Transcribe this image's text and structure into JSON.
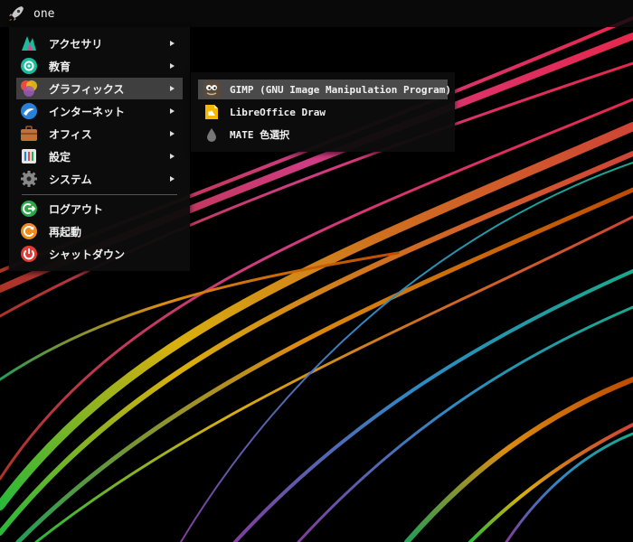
{
  "panel": {
    "launcher_label": "one",
    "launcher_icon": "rocket-icon"
  },
  "main_menu": {
    "items": [
      {
        "label": "アクセサリ",
        "icon": "accessories-icon",
        "submenu": true
      },
      {
        "label": "教育",
        "icon": "education-icon",
        "submenu": true
      },
      {
        "label": "グラフィックス",
        "icon": "graphics-icon",
        "submenu": true,
        "active": true
      },
      {
        "label": "インターネット",
        "icon": "internet-icon",
        "submenu": true
      },
      {
        "label": "オフィス",
        "icon": "office-icon",
        "submenu": true
      },
      {
        "label": "設定",
        "icon": "settings-icon",
        "submenu": true
      },
      {
        "label": "システム",
        "icon": "system-icon",
        "submenu": true
      }
    ],
    "session": [
      {
        "label": "ログアウト",
        "icon": "logout-icon"
      },
      {
        "label": "再起動",
        "icon": "restart-icon"
      },
      {
        "label": "シャットダウン",
        "icon": "shutdown-icon"
      }
    ]
  },
  "graphics_submenu": {
    "items": [
      {
        "label": "GIMP (GNU Image Manipulation Program)",
        "icon": "gimp-icon",
        "active": true
      },
      {
        "label": "LibreOffice Draw",
        "icon": "libreoffice-draw-icon"
      },
      {
        "label": "MATE 色選択",
        "icon": "color-picker-icon"
      }
    ]
  },
  "colors": {
    "menu_bg": "#0c0c0c",
    "highlight": "#3f3f3f",
    "logout": "#2aa84a",
    "restart": "#f08a1c",
    "shutdown": "#e53935"
  }
}
